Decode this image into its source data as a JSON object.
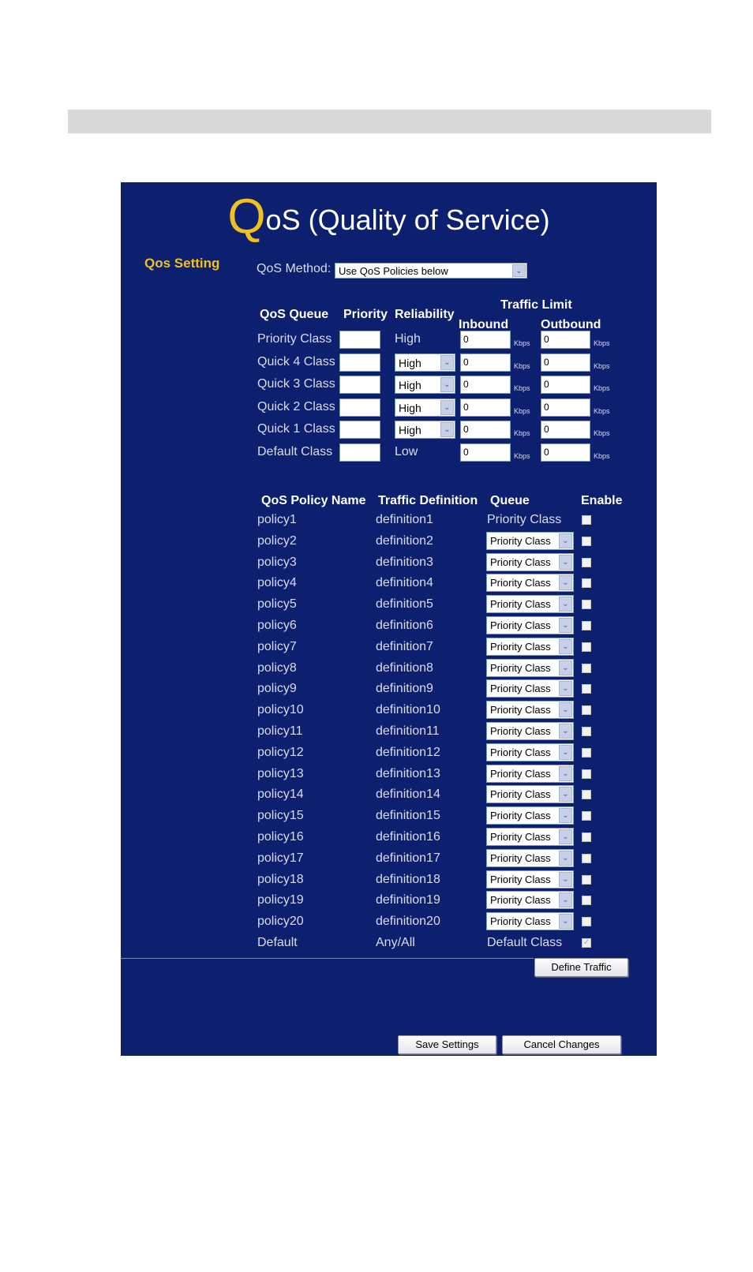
{
  "page": {
    "gray_bar": ""
  },
  "header": {
    "title_initial": "Q",
    "title_rest": "oS (Quality of Service)"
  },
  "settings": {
    "section_label": "Qos Setting",
    "method_label": "QoS Method:",
    "method_value": "Use QoS Policies below"
  },
  "queue_table": {
    "headers": {
      "queue": "QoS Queue",
      "priority": "Priority",
      "reliability": "Reliability",
      "traffic_limit": "Traffic Limit",
      "inbound": "Inbound",
      "outbound": "Outbound"
    },
    "unit": "Kbps",
    "rows": [
      {
        "name": "Priority Class",
        "priority": "",
        "reliability": "High",
        "reliability_editable": false,
        "inbound": "0",
        "outbound": "0"
      },
      {
        "name": "Quick 4 Class",
        "priority": "",
        "reliability": "High",
        "reliability_editable": true,
        "inbound": "0",
        "outbound": "0"
      },
      {
        "name": "Quick 3 Class",
        "priority": "",
        "reliability": "High",
        "reliability_editable": true,
        "inbound": "0",
        "outbound": "0"
      },
      {
        "name": "Quick 2 Class",
        "priority": "",
        "reliability": "High",
        "reliability_editable": true,
        "inbound": "0",
        "outbound": "0"
      },
      {
        "name": "Quick 1 Class",
        "priority": "",
        "reliability": "High",
        "reliability_editable": true,
        "inbound": "0",
        "outbound": "0"
      },
      {
        "name": "Default Class",
        "priority": "",
        "reliability": "Low",
        "reliability_editable": false,
        "inbound": "0",
        "outbound": "0"
      }
    ]
  },
  "policy_table": {
    "headers": {
      "name": "QoS Policy Name",
      "definition": "Traffic Definition",
      "queue": "Queue",
      "enable": "Enable"
    },
    "rows": [
      {
        "name": "policy1",
        "definition": "definition1",
        "queue": "Priority Class",
        "queue_editable": false,
        "enabled": false
      },
      {
        "name": "policy2",
        "definition": "definition2",
        "queue": "Priority Class",
        "queue_editable": true,
        "enabled": false
      },
      {
        "name": "policy3",
        "definition": "definition3",
        "queue": "Priority Class",
        "queue_editable": true,
        "enabled": false
      },
      {
        "name": "policy4",
        "definition": "definition4",
        "queue": "Priority Class",
        "queue_editable": true,
        "enabled": false
      },
      {
        "name": "policy5",
        "definition": "definition5",
        "queue": "Priority Class",
        "queue_editable": true,
        "enabled": false
      },
      {
        "name": "policy6",
        "definition": "definition6",
        "queue": "Priority Class",
        "queue_editable": true,
        "enabled": false
      },
      {
        "name": "policy7",
        "definition": "definition7",
        "queue": "Priority Class",
        "queue_editable": true,
        "enabled": false
      },
      {
        "name": "policy8",
        "definition": "definition8",
        "queue": "Priority Class",
        "queue_editable": true,
        "enabled": false
      },
      {
        "name": "policy9",
        "definition": "definition9",
        "queue": "Priority Class",
        "queue_editable": true,
        "enabled": false
      },
      {
        "name": "policy10",
        "definition": "definition10",
        "queue": "Priority Class",
        "queue_editable": true,
        "enabled": false
      },
      {
        "name": "policy11",
        "definition": "definition11",
        "queue": "Priority Class",
        "queue_editable": true,
        "enabled": false
      },
      {
        "name": "policy12",
        "definition": "definition12",
        "queue": "Priority Class",
        "queue_editable": true,
        "enabled": false
      },
      {
        "name": "policy13",
        "definition": "definition13",
        "queue": "Priority Class",
        "queue_editable": true,
        "enabled": false
      },
      {
        "name": "policy14",
        "definition": "definition14",
        "queue": "Priority Class",
        "queue_editable": true,
        "enabled": false
      },
      {
        "name": "policy15",
        "definition": "definition15",
        "queue": "Priority Class",
        "queue_editable": true,
        "enabled": false
      },
      {
        "name": "policy16",
        "definition": "definition16",
        "queue": "Priority Class",
        "queue_editable": true,
        "enabled": false
      },
      {
        "name": "policy17",
        "definition": "definition17",
        "queue": "Priority Class",
        "queue_editable": true,
        "enabled": false
      },
      {
        "name": "policy18",
        "definition": "definition18",
        "queue": "Priority Class",
        "queue_editable": true,
        "enabled": false
      },
      {
        "name": "policy19",
        "definition": "definition19",
        "queue": "Priority Class",
        "queue_editable": true,
        "enabled": false
      },
      {
        "name": "policy20",
        "definition": "definition20",
        "queue": "Priority Class",
        "queue_editable": true,
        "enabled": false
      },
      {
        "name": "Default",
        "definition": "Any/All",
        "queue": "Default Class",
        "queue_editable": false,
        "enabled": true,
        "enable_disabled": true
      }
    ]
  },
  "buttons": {
    "define_traffic": "Define Traffic",
    "save": "Save Settings",
    "cancel": "Cancel Changes"
  },
  "icons": {
    "dropdown": "chevron-down-icon",
    "checkmark": "✓",
    "arrow_glyph": "⌄"
  },
  "colors": {
    "panel_bg": "#0d2070",
    "accent": "#f0c020",
    "gray_bar": "#d9d9d9"
  }
}
